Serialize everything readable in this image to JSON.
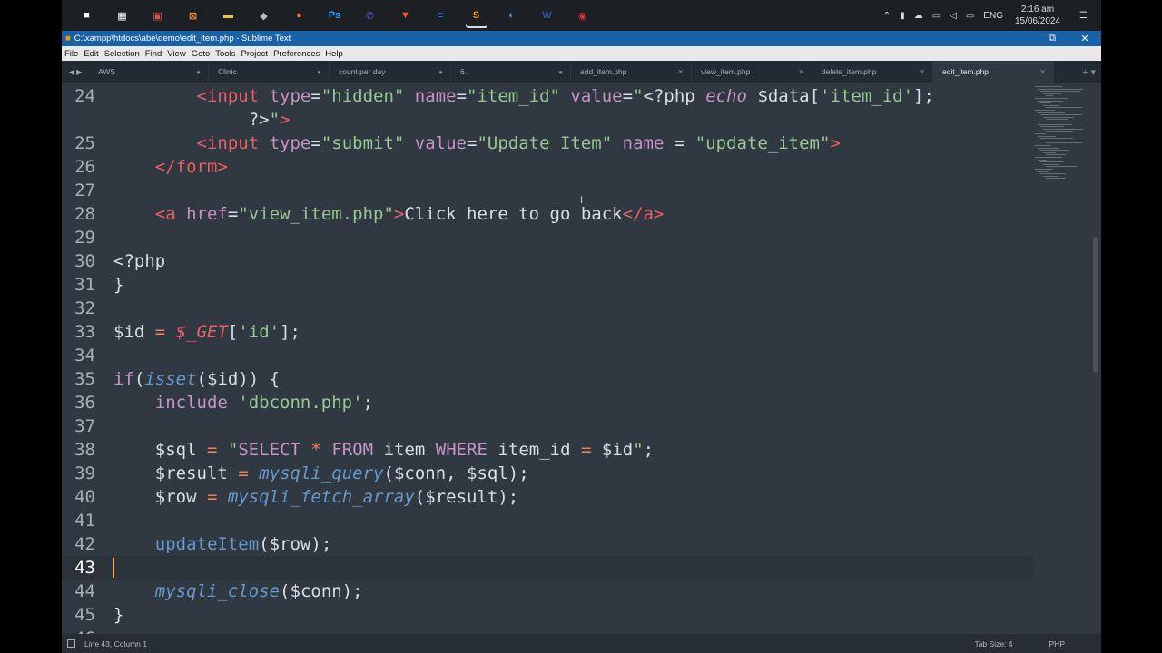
{
  "taskbar": {
    "icons": [
      {
        "name": "stop-icon",
        "glyph": "■",
        "color": "#ffffff"
      },
      {
        "name": "terminal-icon",
        "glyph": "▦",
        "color": "#ffffff"
      },
      {
        "name": "store-icon",
        "glyph": "▣",
        "color": "#e05050"
      },
      {
        "name": "xampp-icon",
        "glyph": "⊠",
        "color": "#f58c32"
      },
      {
        "name": "folder-icon",
        "glyph": "▬",
        "color": "#f3c33b"
      },
      {
        "name": "unity-icon",
        "glyph": "◆",
        "color": "#bbbbbb"
      },
      {
        "name": "firefox-icon",
        "glyph": "●",
        "color": "#ff7139"
      },
      {
        "name": "photoshop-icon",
        "glyph": "Ps",
        "color": "#31a8ff"
      },
      {
        "name": "viber-icon",
        "glyph": "✆",
        "color": "#7360f2"
      },
      {
        "name": "brave-icon",
        "glyph": "▼",
        "color": "#fb542b"
      },
      {
        "name": "notes-icon",
        "glyph": "≡",
        "color": "#3d7ae4"
      },
      {
        "name": "sublime-icon",
        "glyph": "S",
        "color": "#ff9800"
      },
      {
        "name": "edge-icon",
        "glyph": "◐",
        "color": "#2aa8e0"
      },
      {
        "name": "word-icon",
        "glyph": "W",
        "color": "#2b579a"
      },
      {
        "name": "recorder-icon",
        "glyph": "◉",
        "color": "#e03535"
      }
    ],
    "tray": {
      "lang": "ENG",
      "time": "2:16 am",
      "date": "15/06/2024"
    }
  },
  "window": {
    "title": "C:\\xampp\\htdocs\\abe\\demo\\edit_item.php - Sublime Text"
  },
  "menu": [
    "File",
    "Edit",
    "Selection",
    "Find",
    "View",
    "Goto",
    "Tools",
    "Project",
    "Preferences",
    "Help"
  ],
  "tabs": [
    {
      "label": "AWS",
      "width": 132,
      "active": false
    },
    {
      "label": "Clinic",
      "width": 133,
      "active": false
    },
    {
      "label": "count per day",
      "width": 134,
      "active": false
    },
    {
      "label": "6.",
      "width": 132,
      "active": false
    },
    {
      "label": "add_item.php",
      "width": 133,
      "active": false
    },
    {
      "label": "view_item.php",
      "width": 133,
      "active": false
    },
    {
      "label": "delete_item.php",
      "width": 133,
      "active": false
    },
    {
      "label": "edit_item.php",
      "width": 133,
      "active": true
    }
  ],
  "editor": {
    "current_line": 43
  },
  "status": {
    "position": "Line 43, Column 1",
    "tab_size": "Tab Size: 4",
    "syntax": "PHP"
  }
}
